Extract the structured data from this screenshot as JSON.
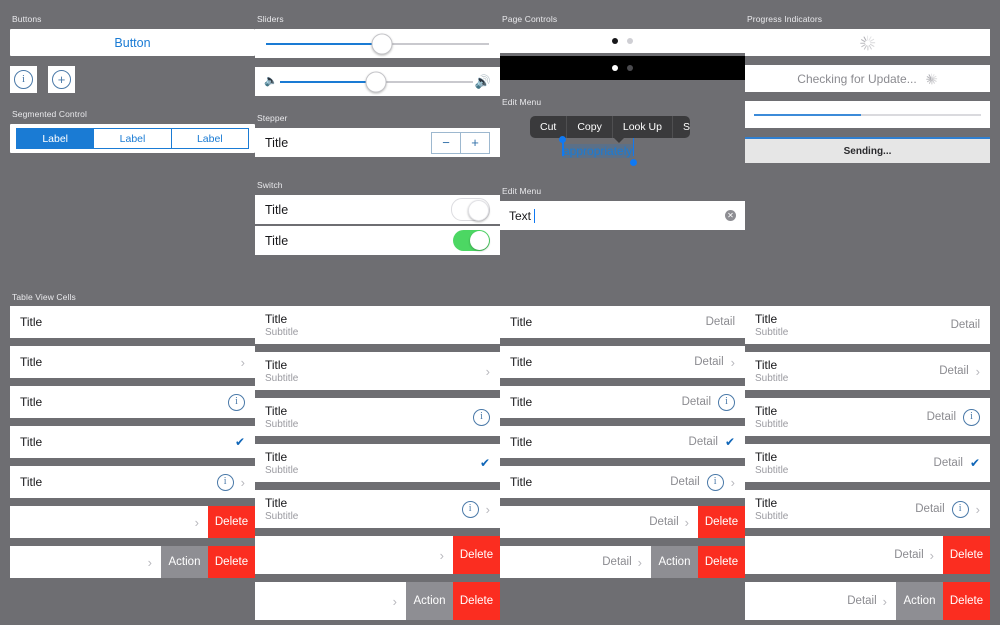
{
  "sections": {
    "buttons": "Buttons",
    "segmented": "Segmented Control",
    "sliders": "Sliders",
    "stepper": "Stepper",
    "switch": "Switch",
    "page_controls": "Page Controls",
    "edit_menu": "Edit Menu",
    "edit_menu_field": "Edit Menu",
    "progress": "Progress Indicators",
    "table_view_cells": "Table View Cells"
  },
  "buttons": {
    "primary_label": "Button",
    "icons": [
      {
        "name": "info-icon",
        "glyph": "i"
      },
      {
        "name": "add-icon",
        "glyph": "+"
      }
    ]
  },
  "segmented_control": {
    "segments": [
      {
        "label": "Label",
        "selected": true
      },
      {
        "label": "Label",
        "selected": false
      },
      {
        "label": "Label",
        "selected": false
      }
    ]
  },
  "sliders": [
    {
      "name": "plain-slider",
      "value_pct": 52,
      "left_icon": null,
      "right_icon": null
    },
    {
      "name": "volume-slider",
      "value_pct": 50,
      "left_icon": "speaker-low-icon",
      "right_icon": "speaker-high-icon"
    }
  ],
  "stepper": {
    "title": "Title",
    "decrement_label": "−",
    "increment_label": "+"
  },
  "switches": [
    {
      "title": "Title",
      "on": false
    },
    {
      "title": "Title",
      "on": true
    }
  ],
  "page_controls": [
    {
      "style": "light",
      "pages": 2,
      "current": 0
    },
    {
      "style": "dark",
      "pages": 2,
      "current": 0
    }
  ],
  "edit_menu": {
    "items": [
      "Cut",
      "Copy",
      "Look Up",
      "Share..."
    ],
    "selected_text": "appropriately"
  },
  "text_field": {
    "value": "Text",
    "placeholder": "Text",
    "clear_glyph": "✕"
  },
  "progress": {
    "spinner_only": {
      "name": "activity-indicator"
    },
    "labeled": {
      "text": "Checking for Update..."
    },
    "bar": {
      "value_pct": 47
    },
    "toolbar": {
      "text": "Sending...",
      "value_pct": 100
    }
  },
  "colors": {
    "background": "#6e6e72",
    "accent_blue": "#1a7bd4",
    "switch_on_green": "#4cd763",
    "delete_red": "#fb2d20",
    "action_gray": "#8e8e93",
    "panel_white": "#ffffff",
    "dark_menu": "#3a3a3c",
    "selection_blue": "#1079f2"
  },
  "table_view_cells": {
    "labels": {
      "title": "Title",
      "subtitle": "Subtitle",
      "detail": "Detail"
    },
    "swipe_actions": {
      "delete": "Delete",
      "action": "Action"
    },
    "columns": [
      {
        "name": "basic",
        "rows": [
          {
            "title": "Title",
            "accessory": "none"
          },
          {
            "title": "Title",
            "accessory": "chevron"
          },
          {
            "title": "Title",
            "accessory": "info"
          },
          {
            "title": "Title",
            "accessory": "check"
          },
          {
            "title": "Title",
            "accessory": "info-chevron"
          },
          {
            "title": "",
            "accessory": "chevron",
            "swipe": [
              "Delete"
            ]
          },
          {
            "title": "",
            "accessory": "chevron",
            "swipe": [
              "Action",
              "Delete"
            ]
          }
        ]
      },
      {
        "name": "subtitle",
        "rows": [
          {
            "title": "Title",
            "subtitle": "Subtitle",
            "accessory": "none"
          },
          {
            "title": "Title",
            "subtitle": "Subtitle",
            "accessory": "chevron"
          },
          {
            "title": "Title",
            "subtitle": "Subtitle",
            "accessory": "info"
          },
          {
            "title": "Title",
            "subtitle": "Subtitle",
            "accessory": "check"
          },
          {
            "title": "Title",
            "subtitle": "Subtitle",
            "accessory": "info-chevron"
          },
          {
            "title": "",
            "accessory": "chevron",
            "swipe": [
              "Delete"
            ]
          },
          {
            "title": "",
            "accessory": "chevron",
            "swipe": [
              "Action",
              "Delete"
            ]
          }
        ]
      },
      {
        "name": "right-detail",
        "rows": [
          {
            "title": "Title",
            "detail": "Detail",
            "accessory": "none"
          },
          {
            "title": "Title",
            "detail": "Detail",
            "accessory": "chevron"
          },
          {
            "title": "Title",
            "detail": "Detail",
            "accessory": "info"
          },
          {
            "title": "Title",
            "detail": "Detail",
            "accessory": "check"
          },
          {
            "title": "Title",
            "detail": "Detail",
            "accessory": "info-chevron"
          },
          {
            "title": "",
            "detail": "Detail",
            "accessory": "chevron",
            "swipe": [
              "Delete"
            ]
          },
          {
            "title": "",
            "detail": "Detail",
            "accessory": "chevron",
            "swipe": [
              "Action",
              "Delete"
            ]
          }
        ]
      },
      {
        "name": "subtitle-detail",
        "rows": [
          {
            "title": "Title",
            "subtitle": "Subtitle",
            "detail": "Detail",
            "accessory": "none"
          },
          {
            "title": "Title",
            "subtitle": "Subtitle",
            "detail": "Detail",
            "accessory": "chevron"
          },
          {
            "title": "Title",
            "subtitle": "Subtitle",
            "detail": "Detail",
            "accessory": "info"
          },
          {
            "title": "Title",
            "subtitle": "Subtitle",
            "detail": "Detail",
            "accessory": "check"
          },
          {
            "title": "Title",
            "subtitle": "Subtitle",
            "detail": "Detail",
            "accessory": "info-chevron"
          },
          {
            "title": "",
            "detail": "Detail",
            "accessory": "chevron",
            "swipe": [
              "Delete"
            ]
          },
          {
            "title": "",
            "detail": "Detail",
            "accessory": "chevron",
            "swipe": [
              "Action",
              "Delete"
            ]
          }
        ]
      }
    ]
  }
}
